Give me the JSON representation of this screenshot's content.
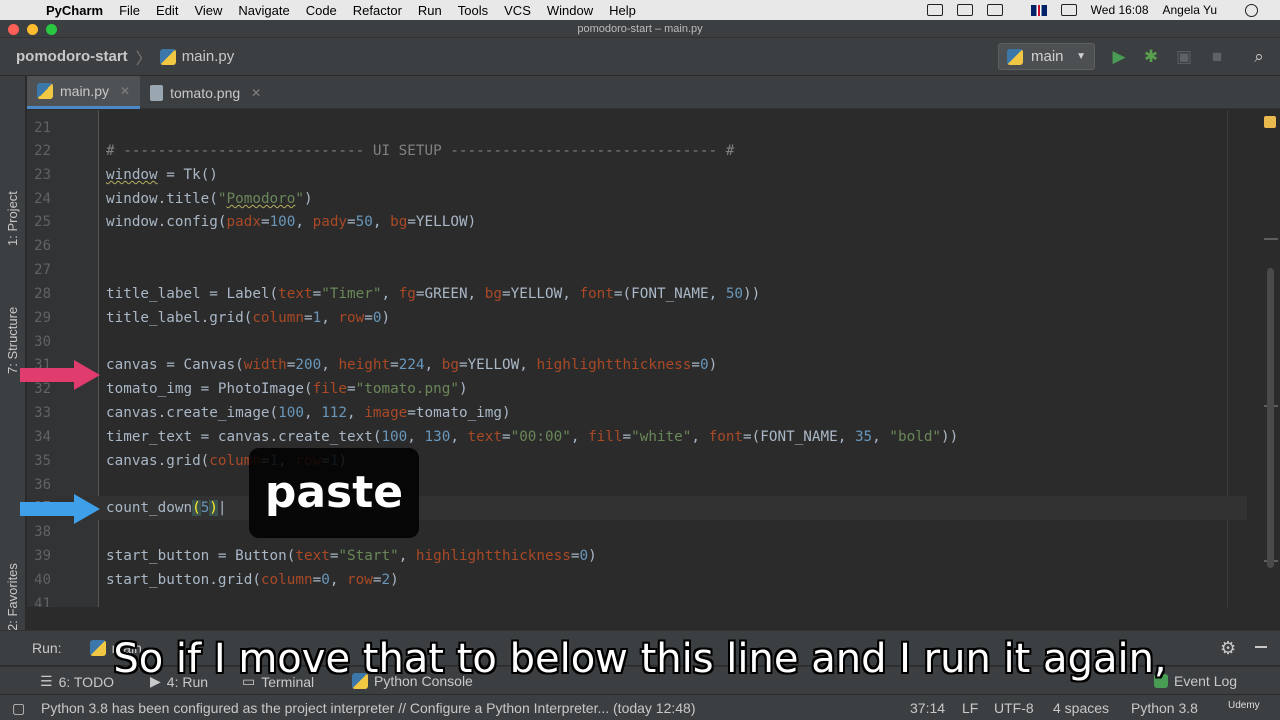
{
  "menubar": {
    "app": "PyCharm",
    "items": [
      "File",
      "Edit",
      "View",
      "Navigate",
      "Code",
      "Refactor",
      "Run",
      "Tools",
      "VCS",
      "Window",
      "Help"
    ],
    "clock": "Wed 16:08",
    "user": "Angela Yu"
  },
  "window": {
    "title": "pomodoro-start – main.py"
  },
  "navbar": {
    "project": "pomodoro-start",
    "file": "main.py",
    "run_config": "main"
  },
  "left_tabs": {
    "project": "1: Project",
    "structure": "7: Structure",
    "favorites": "2: Favorites"
  },
  "tabs": [
    {
      "label": "main.py"
    },
    {
      "label": "tomato.png"
    }
  ],
  "editor": {
    "lines": [
      {
        "num": "21"
      },
      {
        "num": "22"
      },
      {
        "num": "23"
      },
      {
        "num": "24"
      },
      {
        "num": "25"
      },
      {
        "num": "26"
      },
      {
        "num": "27"
      },
      {
        "num": "28"
      },
      {
        "num": "29"
      },
      {
        "num": "30"
      },
      {
        "num": "31"
      },
      {
        "num": "32"
      },
      {
        "num": "33"
      },
      {
        "num": "34"
      },
      {
        "num": "35"
      },
      {
        "num": "36"
      },
      {
        "num": "37"
      },
      {
        "num": "38"
      },
      {
        "num": "39"
      },
      {
        "num": "40"
      },
      {
        "num": "41"
      }
    ]
  },
  "overlay": {
    "paste": "paste"
  },
  "run_panel": {
    "label": "Run:",
    "tab": "main"
  },
  "tool_windows": {
    "todo": "6: TODO",
    "run": "4: Run",
    "terminal": "Terminal",
    "python_console": "Python Console",
    "event_log": "Event Log"
  },
  "status": {
    "message": "Python 3.8 has been configured as the project interpreter // Configure a Python Interpreter... (today 12:48)",
    "position": "37:14",
    "line_sep": "LF",
    "encoding": "UTF-8",
    "indent": "4 spaces",
    "interpreter": "Python 3.8"
  },
  "caption": "So if I move that to below this line and I run it again,",
  "watermark": "Udemy"
}
